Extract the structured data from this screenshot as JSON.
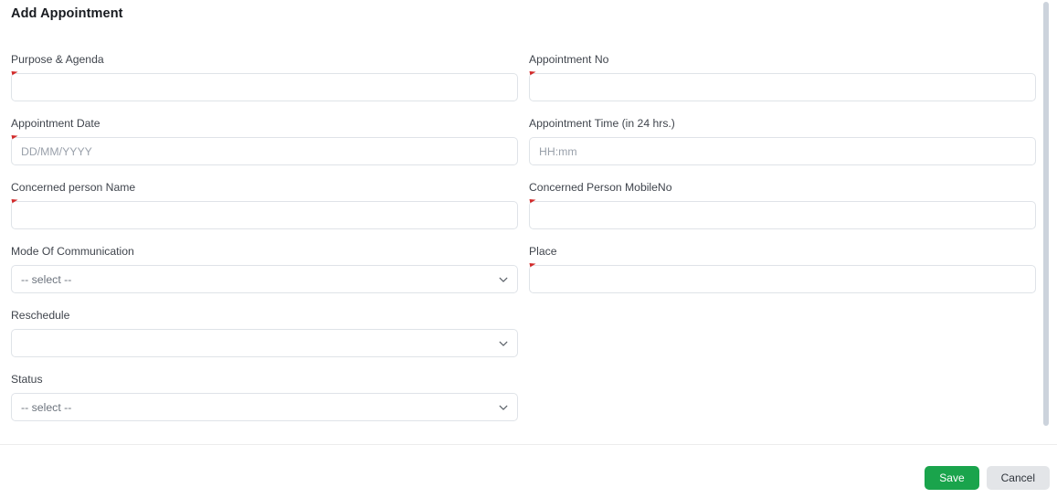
{
  "page": {
    "title": "Add Appointment"
  },
  "theme": {
    "save_green": "#1aa44c",
    "cancel_gray": "#e3e5e8",
    "required_marker_red": "#d22a2a",
    "label_gray": "#40454d",
    "placeholder_gray": "#9aa1ab",
    "input_border": "#dfe3e8",
    "card_bg": "#ffffff",
    "scrollbar_thumb": "#ccd3dc"
  },
  "form": {
    "rows": [
      {
        "left": {
          "label": "Purpose & Agenda",
          "type": "text",
          "value": "",
          "placeholder": "",
          "required": true
        },
        "right": {
          "label": "Appointment No",
          "type": "text",
          "value": "",
          "placeholder": "",
          "required": true
        }
      },
      {
        "left": {
          "label": "Appointment Date",
          "type": "text",
          "value": "",
          "placeholder": "DD/MM/YYYY",
          "required": true
        },
        "right": {
          "label": "Appointment Time (in 24 hrs.)",
          "type": "text",
          "value": "",
          "placeholder": "HH:mm",
          "required": false
        }
      },
      {
        "left": {
          "label": "Concerned person Name",
          "type": "text",
          "value": "",
          "placeholder": "",
          "required": true
        },
        "right": {
          "label": "Concerned Person MobileNo",
          "type": "text",
          "value": "",
          "placeholder": "",
          "required": true
        }
      },
      {
        "left": {
          "label": "Mode Of Communication",
          "type": "select",
          "value": "-- select --",
          "required": false
        },
        "right": {
          "label": "Place",
          "type": "text",
          "value": "",
          "placeholder": "",
          "required": true
        }
      },
      {
        "left": {
          "label": "Reschedule",
          "type": "select",
          "value": "",
          "required": false
        },
        "right": null
      },
      {
        "left": {
          "label": "Status",
          "type": "select",
          "value": "-- select --",
          "required": false
        },
        "right": null
      }
    ]
  },
  "footer": {
    "save_label": "Save",
    "cancel_label": "Cancel"
  },
  "icons": {
    "chevron_down": "chevron-down-icon",
    "required_flag": "required-marker-icon"
  }
}
